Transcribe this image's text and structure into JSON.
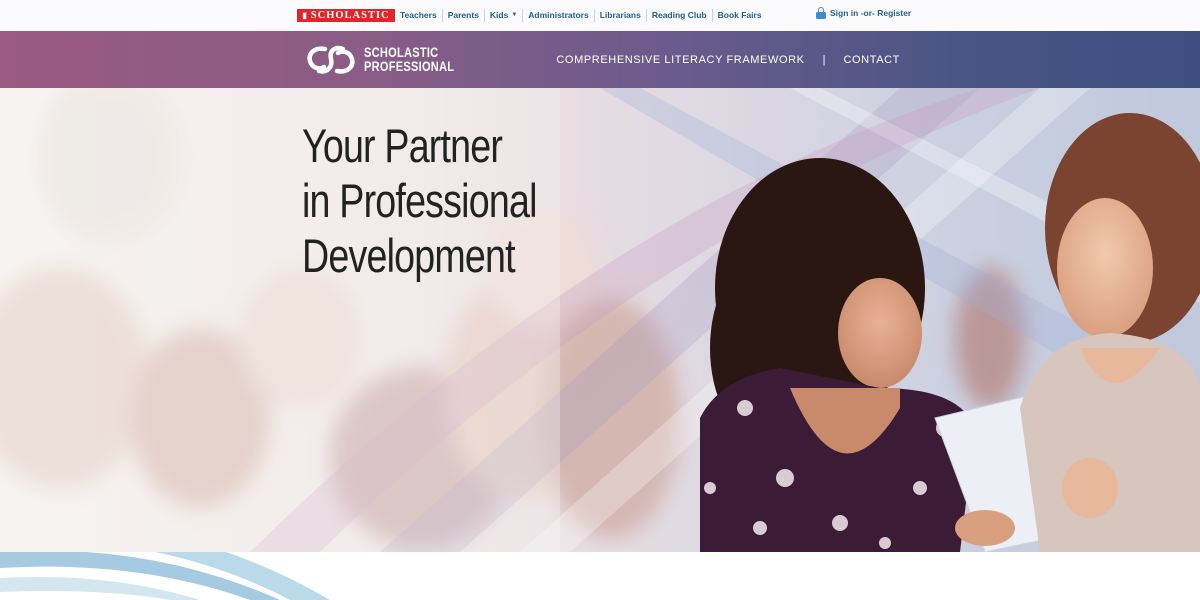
{
  "topbar": {
    "brand": "SCHOLASTIC",
    "nav": [
      {
        "label": "Teachers"
      },
      {
        "label": "Parents"
      },
      {
        "label": "Kids",
        "has_dropdown": true
      },
      {
        "label": "Administrators"
      },
      {
        "label": "Librarians"
      },
      {
        "label": "Reading Club"
      },
      {
        "label": "Book Fairs"
      }
    ],
    "signin": "Sign in -or- Register",
    "signin_icon": "lock-icon"
  },
  "header": {
    "logo_line1": "SCHOLASTIC",
    "logo_line2": "PROFESSIONAL",
    "nav": [
      {
        "label": "COMPREHENSIVE LITERACY FRAMEWORK"
      },
      {
        "label": "CONTACT"
      }
    ],
    "separator": "|"
  },
  "hero": {
    "headline_lines": [
      "Your Partner",
      "in Professional",
      "Development"
    ]
  },
  "colors": {
    "scholastic_red": "#e2242b",
    "link_blue": "#1c5f8f",
    "header_left": "#9a5a82",
    "header_right": "#3c4f7f"
  }
}
